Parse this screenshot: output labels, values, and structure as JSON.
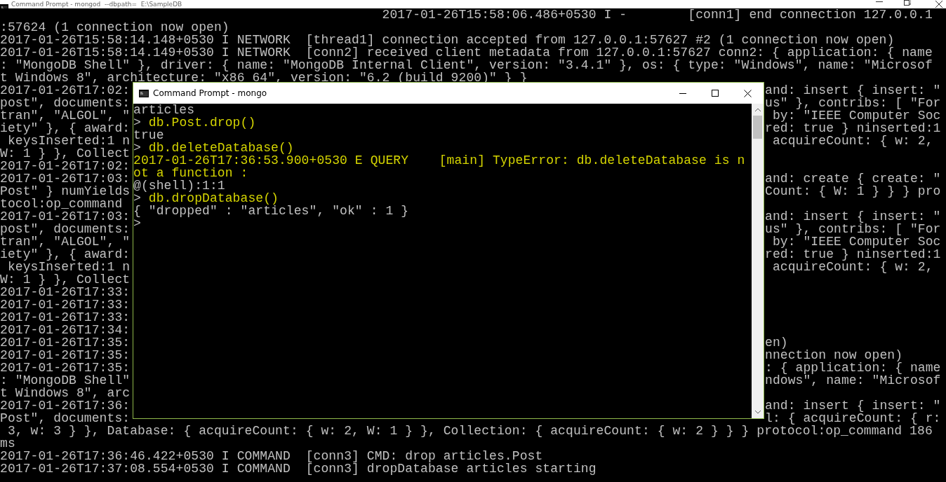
{
  "back_window": {
    "title": "Command Prompt - mongod  --dbpath=  E:\\SampleDB",
    "top_lines": [
      "                                                  2017-01-26T15:58:06.486+0530 I -        [conn1] end connection 127.0.0.1",
      ":57624 (1 connection now open)",
      "2017-01-26T15:58:14.148+0530 I NETWORK  [thread1] connection accepted from 127.0.0.1:57627 #2 (1 connection now open)",
      "2017-01-26T15:58:14.149+0530 I NETWORK  [conn2] received client metadata from 127.0.0.1:57627 conn2: { application: { name",
      ": \"MongoDB Shell\" }, driver: { name: \"MongoDB Internal Client\", version: \"3.4.1\" }, os: { type: \"Windows\", name: \"Microsof",
      "t Windows 8\", architecture: \"x86_64\", version: \"6.2 (build 9200)\" } }"
    ],
    "covered_lines": [
      {
        "left": "2017-01-26T17:02:",
        "right": "and: insert { insert: \""
      },
      {
        "left": "post\", documents:",
        "right": "us\" }, contribs: [ \"For"
      },
      {
        "left": "tran\", \"ALGOL\", \"",
        "right": " by: \"IEEE Computer Soc"
      },
      {
        "left": "iety\" }, { award:",
        "right": "red: true } ninserted:1"
      },
      {
        "left": " keysInserted:1 n",
        "right": " acquireCount: { w: 2,"
      },
      {
        "left": "W: 1 } }, Collect"
      },
      {
        "left": "2017-01-26T17:02:"
      },
      {
        "left": "2017-01-26T17:03:",
        "right": "and: create { create: \""
      },
      {
        "left": "Post\" } numYields",
        "right": "Count: { W: 1 } } } pro"
      },
      {
        "left": "tocol:op_command"
      },
      {
        "left": "2017-01-26T17:03:",
        "right": "and: insert { insert: \""
      },
      {
        "left": "post\", documents:",
        "right": "us\" }, contribs: [ \"For"
      },
      {
        "left": "tran\", \"ALGOL\", \"",
        "right": " by: \"IEEE Computer Soc"
      },
      {
        "left": "iety\" }, { award:",
        "right": "red: true } ninserted:1"
      },
      {
        "left": " keysInserted:1 n",
        "right": " acquireCount: { w: 2,"
      },
      {
        "left": "W: 1 } }, Collect"
      },
      {
        "left": "2017-01-26T17:33:"
      },
      {
        "left": "2017-01-26T17:33:"
      },
      {
        "left": "2017-01-26T17:33:"
      },
      {
        "left": "2017-01-26T17:34:"
      },
      {
        "left": "2017-01-26T17:35:",
        "right": "en)"
      },
      {
        "left": "2017-01-26T17:35:",
        "right": "nnection now open)"
      },
      {
        "left": "2017-01-26T17:35:",
        "right": ": { application: { name"
      },
      {
        "left": ": \"MongoDB Shell\"",
        "right": "ndows\", name: \"Microsof"
      },
      {
        "left": "t Windows 8\", arc"
      },
      {
        "left": "2017-01-26T17:36:",
        "right": "and: insert { insert: \""
      },
      {
        "left": "Post\", documents:",
        "right": "l: { acquireCount: { r:"
      }
    ],
    "bottom_lines": [
      " 3, w: 3 } }, Database: { acquireCount: { w: 2, W: 1 } }, Collection: { acquireCount: { w: 2 } } } protocol:op_command 186",
      "ms",
      "2017-01-26T17:36:46.422+0530 I COMMAND  [conn3] CMD: drop articles.Post",
      "2017-01-26T17:37:08.554+0530 I COMMAND  [conn3] dropDatabase articles starting"
    ]
  },
  "front_window": {
    "title": "Command Prompt - mongo",
    "lines": [
      {
        "kind": "output",
        "text": "articles"
      },
      {
        "kind": "input",
        "prompt": ">",
        "command": "db.Post.drop()"
      },
      {
        "kind": "output",
        "text": "true"
      },
      {
        "kind": "input",
        "prompt": ">",
        "command": "db.deleteDatabase()"
      },
      {
        "kind": "error",
        "text": "2017-01-26T17:36:53.900+0530 E QUERY    [main] TypeError: db.deleteDatabase is n"
      },
      {
        "kind": "error",
        "text": "ot a function :"
      },
      {
        "kind": "output",
        "text": "@(shell):1:1"
      },
      {
        "kind": "input",
        "prompt": ">",
        "command": "db.dropDatabase()"
      },
      {
        "kind": "output",
        "text": "{ \"dropped\" : \"articles\", \"ok\" : 1 }"
      },
      {
        "kind": "input",
        "prompt": ">"
      }
    ]
  }
}
